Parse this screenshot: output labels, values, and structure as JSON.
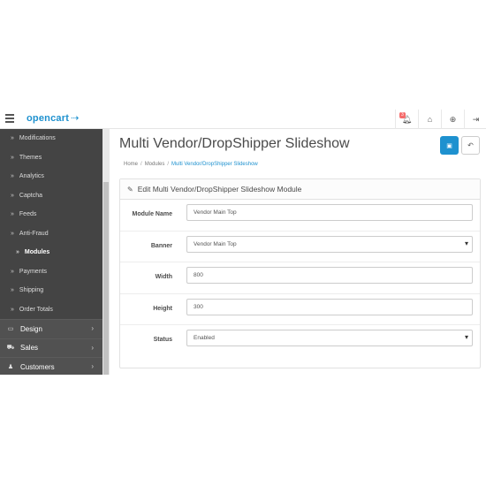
{
  "header": {
    "logo_text": "opencart",
    "logo_cart": "⟶🛒",
    "notification_count": "3",
    "icons": [
      "bell-icon",
      "home-icon",
      "help-icon",
      "logout-icon"
    ]
  },
  "sidebar": {
    "subitems": [
      {
        "label": "Modifications"
      },
      {
        "label": "Themes"
      },
      {
        "label": "Analytics"
      },
      {
        "label": "Captcha"
      },
      {
        "label": "Feeds"
      },
      {
        "label": "Anti-Fraud"
      },
      {
        "label": "Modules",
        "active": true
      },
      {
        "label": "Payments"
      },
      {
        "label": "Shipping"
      },
      {
        "label": "Order Totals"
      }
    ],
    "main": [
      {
        "label": "Design",
        "icon": "monitor-icon"
      },
      {
        "label": "Sales",
        "icon": "cart-icon"
      },
      {
        "label": "Customers",
        "icon": "user-icon"
      }
    ]
  },
  "page": {
    "title": "Multi Vendor/DropShipper Slideshow",
    "breadcrumb": {
      "home": "Home",
      "modules": "Modules",
      "current": "Multi Vendor/DropShipper Slideshow"
    },
    "panel_title": "Edit Multi Vendor/DropShipper Slideshow Module"
  },
  "form": {
    "module_name": {
      "label": "Module Name",
      "value": "Vendor Main Top"
    },
    "banner": {
      "label": "Banner",
      "value": "Vendor Main Top"
    },
    "width": {
      "label": "Width",
      "value": "800"
    },
    "height": {
      "label": "Height",
      "value": "300"
    },
    "status": {
      "label": "Status",
      "value": "Enabled"
    }
  },
  "colors": {
    "accent": "#1e91cf",
    "sidebar": "#515151",
    "badge": "#f56b6b"
  }
}
